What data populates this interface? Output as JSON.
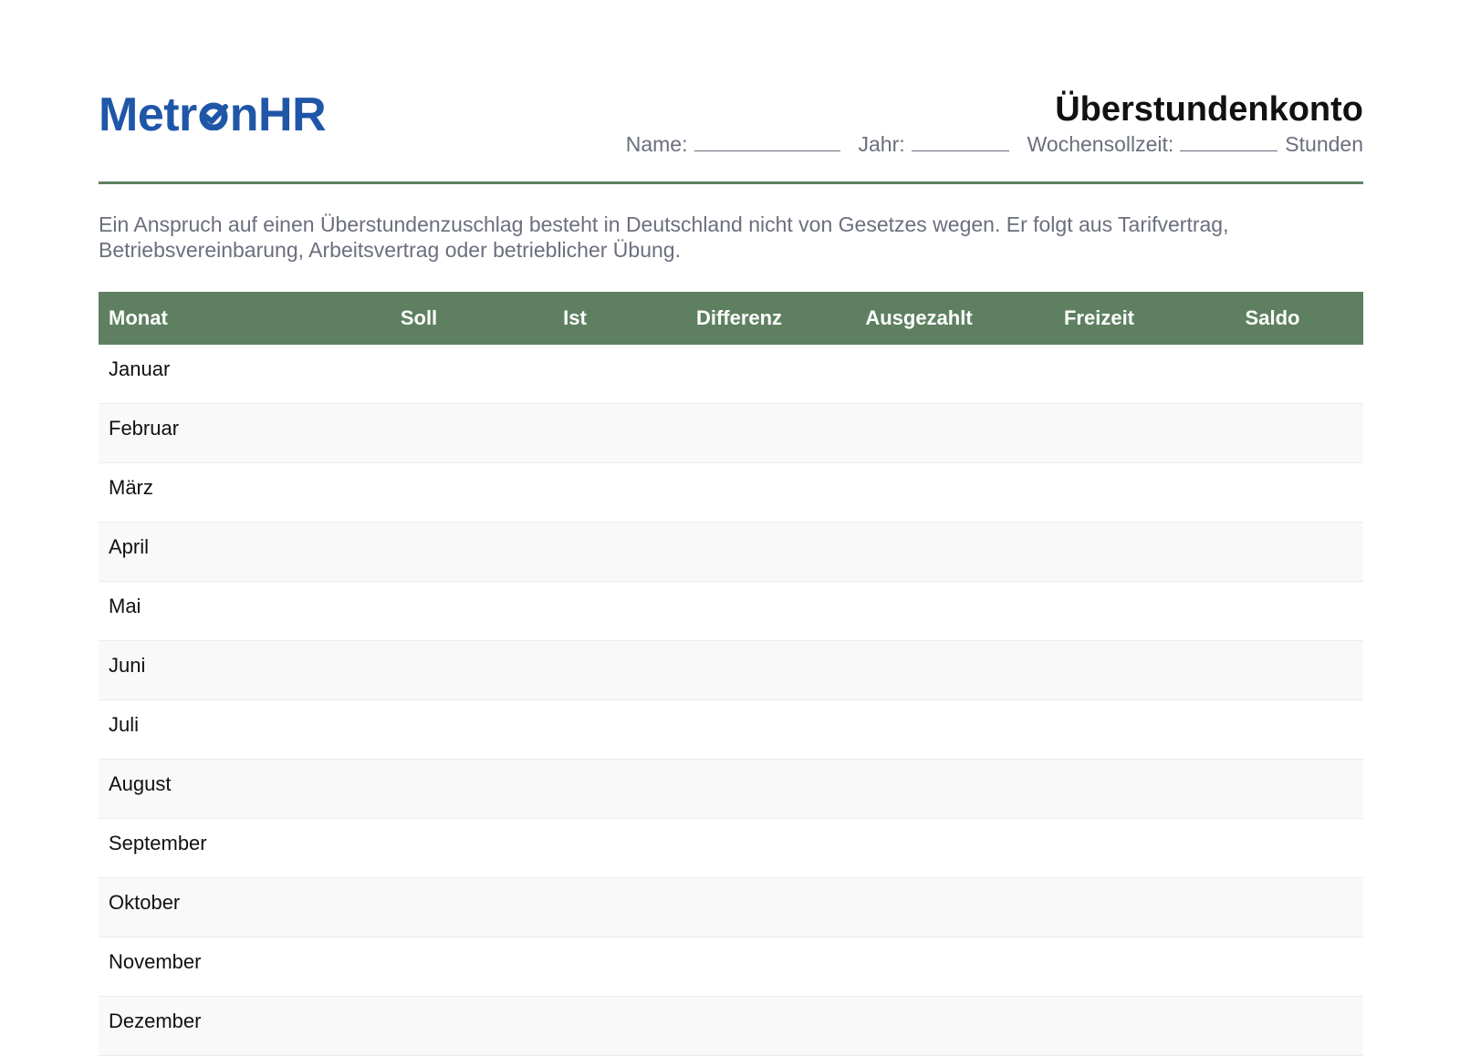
{
  "logo": {
    "part1": "Metr",
    "part2": "nHR"
  },
  "header": {
    "title": "Überstundenkonto",
    "name_label": "Name:",
    "year_label": "Jahr:",
    "weekly_label": "Wochensollzeit:",
    "hours_unit": "Stunden"
  },
  "intro": {
    "text": "Ein Anspruch auf einen Überstundenzuschlag besteht in Deutschland nicht von Gesetzes wegen. Er folgt aus Tarifvertrag, Betriebsvereinbarung, Arbeitsvertrag oder betrieblicher Übung."
  },
  "colors": {
    "brand_blue": "#1f56a8",
    "header_green": "#5e8061",
    "muted_text": "#6b6f7d"
  },
  "table": {
    "columns": [
      "Monat",
      "Soll",
      "Ist",
      "Differenz",
      "Ausgezahlt",
      "Freizeit",
      "Saldo"
    ],
    "months": [
      "Januar",
      "Februar",
      "März",
      "April",
      "Mai",
      "Juni",
      "Juli",
      "August",
      "September",
      "Oktober",
      "November",
      "Dezember"
    ]
  }
}
